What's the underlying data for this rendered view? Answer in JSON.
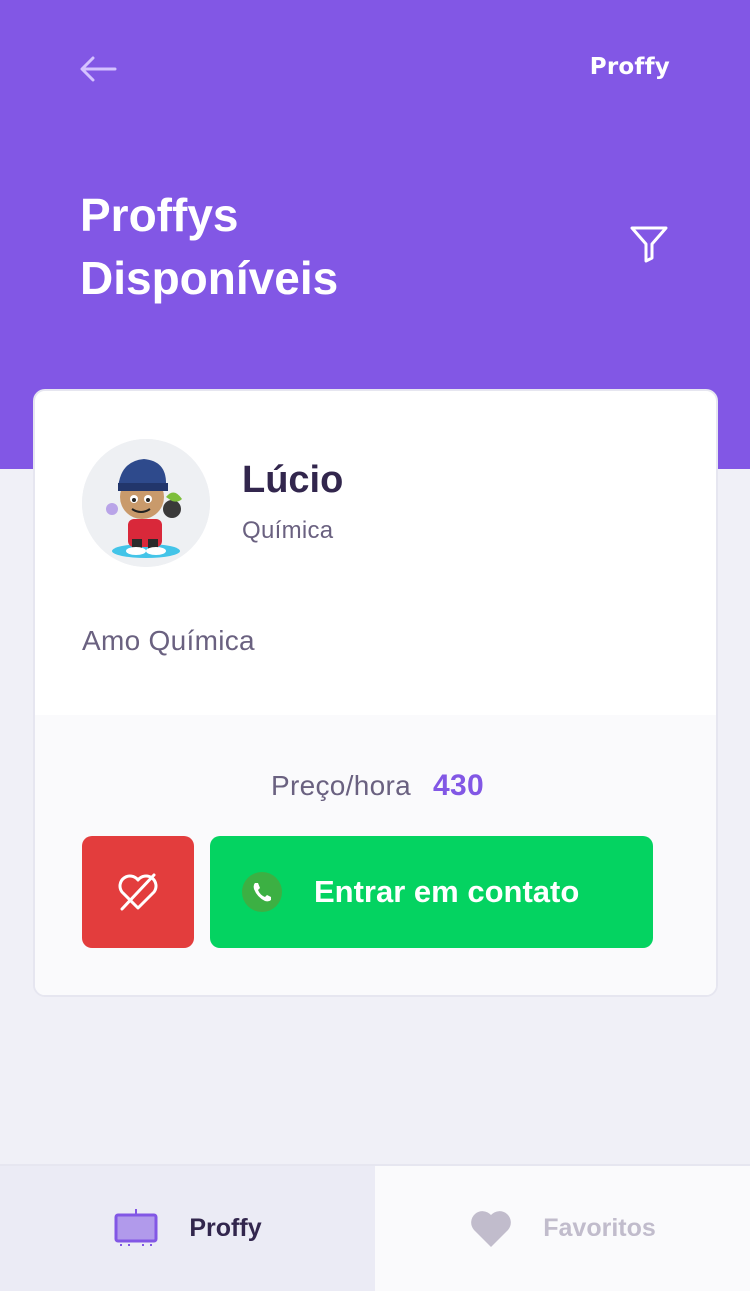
{
  "header": {
    "logo": "Proffy",
    "title_line1": "Proffys",
    "title_line2": "Disponíveis"
  },
  "icons": {
    "back": "arrow-left-icon",
    "filter": "filter-icon",
    "favorite_remove": "heart-off-icon",
    "whatsapp": "whatsapp-icon",
    "tab_proffy": "tv-icon",
    "tab_favorites": "heart-icon"
  },
  "teacher": {
    "name": "Lúcio",
    "subject": "Química",
    "bio": "Amo Química",
    "price_label": "Preço/hora",
    "price_value": "430",
    "contact_label": "Entrar em contato"
  },
  "tabs": [
    {
      "label": "Proffy",
      "active": true
    },
    {
      "label": "Favoritos",
      "active": false
    }
  ],
  "colors": {
    "primary": "#8257E5",
    "background": "#F0F0F7",
    "danger": "#E33D3D",
    "success": "#04D361",
    "title_text": "#32264D",
    "body_text": "#6A6180",
    "inactive_text": "#C1BCCC"
  }
}
